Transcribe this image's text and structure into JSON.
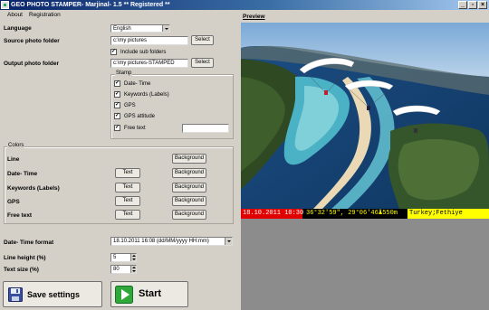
{
  "window": {
    "title": "GEO PHOTO STAMPER- Marjinal- 1.5 ** Registered **"
  },
  "menu": [
    "About",
    "Registration"
  ],
  "form": {
    "language_label": "Language",
    "language_value": "English",
    "source_label": "Source photo folder",
    "source_value": "c:\\my pictures",
    "source_select": "Select",
    "include_sub_label": "Include sub folders",
    "include_sub_checked": true,
    "output_label": "Output photo folder",
    "output_value": "c:\\my pictures-STAMPED",
    "output_select": "Select"
  },
  "stamp": {
    "title": "Stamp",
    "items": [
      {
        "label": "Date- Time",
        "checked": true
      },
      {
        "label": "Keywords (Labels)",
        "checked": true
      },
      {
        "label": "GPS",
        "checked": true
      },
      {
        "label": "GPS attitude",
        "checked": true
      },
      {
        "label": "Free text",
        "checked": true
      }
    ],
    "free_text_value": ""
  },
  "colors": {
    "title": "Colors",
    "text_label": "Text",
    "bg_label": "Background",
    "rows": [
      {
        "label": "Line",
        "has_text": false
      },
      {
        "label": "Date- Time",
        "has_text": true
      },
      {
        "label": "Keywords (Labels)",
        "has_text": true
      },
      {
        "label": "GPS",
        "has_text": true
      },
      {
        "label": "Free text",
        "has_text": true
      }
    ]
  },
  "settings": {
    "datetime_format_label": "Date- Time format",
    "datetime_format_value": "18.10.2011 16:08 (dd/MM/yyyy HH:mm)",
    "line_height_label": "Line height (%)",
    "line_height_value": "5",
    "text_size_label": "Text size (%)",
    "text_size_value": "80"
  },
  "buttons": {
    "save": "Save settings",
    "start": "Start"
  },
  "preview": {
    "label": "Preview",
    "stamp_date": "18.10.2011 10:30",
    "stamp_gps": "36°32'59\",  29°06'46\"",
    "stamp_altitude": "▲550m",
    "stamp_free": "Turkey;Fethiye",
    "date_bg": "#e00000",
    "gps_color": "#ffff00",
    "free_bg": "#ffff00"
  }
}
